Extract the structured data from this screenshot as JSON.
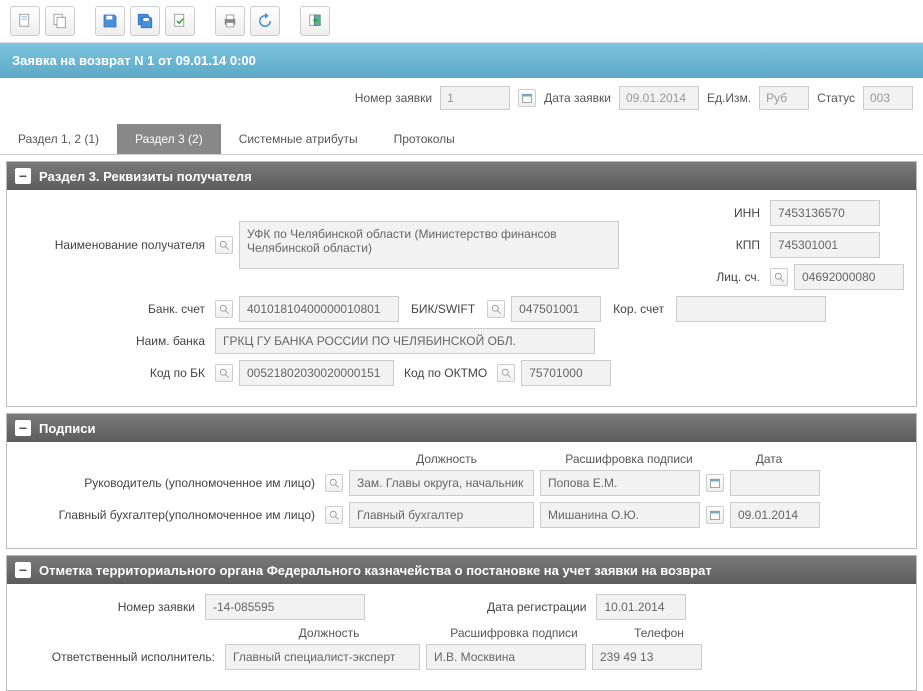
{
  "title": "Заявка на возврат N 1 от 09.01.14 0:00",
  "header": {
    "number_label": "Номер заявки",
    "number": "1",
    "date_label": "Дата заявки",
    "date": "09.01.2014",
    "unit_label": "Ед.Изм.",
    "unit": "Руб",
    "status_label": "Статус",
    "status": "003"
  },
  "tabs": {
    "t1": "Раздел 1, 2 (1)",
    "t2": "Раздел 3 (2)",
    "t3": "Системные атрибуты",
    "t4": "Протоколы"
  },
  "section3": {
    "title": "Раздел 3. Реквизиты получателя",
    "recipient_label": "Наименование получателя",
    "recipient": "УФК по Челябинской области (Министерство финансов Челябинской области)",
    "inn_label": "ИНН",
    "inn": "7453136570",
    "kpp_label": "КПП",
    "kpp": "745301001",
    "lic_label": "Лиц. сч.",
    "lic": "04692000080",
    "bank_acc_label": "Банк. счет",
    "bank_acc": "40101810400000010801",
    "bik_label": "БИК/SWIFT",
    "bik": "047501001",
    "kor_label": "Кор. счет",
    "kor": "",
    "bank_name_label": "Наим. банка",
    "bank_name": "ГРКЦ ГУ БАНКА РОССИИ ПО ЧЕЛЯБИНСКОЙ ОБЛ.",
    "bk_label": "Код по БК",
    "bk": "00521802030020000151",
    "oktmo_label": "Код по ОКТМО",
    "oktmo": "75701000"
  },
  "signatures": {
    "title": "Подписи",
    "col_position": "Должность",
    "col_name": "Расшифровка подписи",
    "col_date": "Дата",
    "head_label": "Руководитель (уполномоченное им лицо)",
    "head_position": "Зам. Главы округа, начальник",
    "head_name": "Попова Е.М.",
    "head_date": "",
    "acc_label": "Главный бухгалтер(уполномоченное им лицо)",
    "acc_position": "Главный бухгалтер",
    "acc_name": "Мишанина О.Ю.",
    "acc_date": "09.01.2014"
  },
  "treasury": {
    "title": "Отметка территориального органа Федерального казначейства о постановке на учет заявки на возврат",
    "num_label": "Номер заявки",
    "num": "-14-085595",
    "reg_date_label": "Дата регистрации",
    "reg_date": "10.01.2014",
    "col_position": "Должность",
    "col_name": "Расшифровка подписи",
    "col_phone": "Телефон",
    "resp_label": "Ответственный исполнитель:",
    "resp_position": "Главный специалист-эксперт",
    "resp_name": "И.В. Москвина",
    "resp_phone": "239 49 13"
  }
}
